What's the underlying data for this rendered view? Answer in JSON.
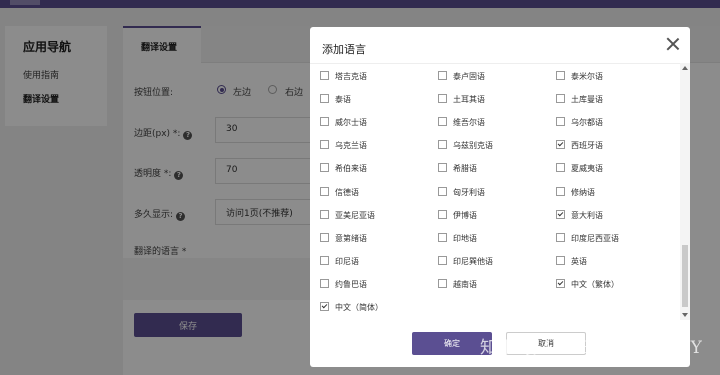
{
  "sidebar": {
    "title": "应用导航",
    "items": [
      {
        "label": "使用指南"
      },
      {
        "label": "翻译设置"
      }
    ]
  },
  "main": {
    "tab": "翻译设置",
    "button_position_label": "按钮位置:",
    "position_left": "左边",
    "position_right": "右边",
    "margin_label": "边距(px) *:",
    "margin_value": "30",
    "opacity_label": "透明度 *:",
    "opacity_value": "70",
    "show_when_label": "多久显示:",
    "show_when_value": "访问1页(不推荐)",
    "languages_label": "翻译的语言 *",
    "save": "保存"
  },
  "dialog": {
    "title": "添加语言",
    "languages": [
      {
        "label": "塔吉克语",
        "checked": false
      },
      {
        "label": "泰卢固语",
        "checked": false
      },
      {
        "label": "泰米尔语",
        "checked": false
      },
      {
        "label": "泰语",
        "checked": false
      },
      {
        "label": "土耳其语",
        "checked": false
      },
      {
        "label": "土库曼语",
        "checked": false
      },
      {
        "label": "威尔士语",
        "checked": false
      },
      {
        "label": "维吾尔语",
        "checked": false
      },
      {
        "label": "乌尔都语",
        "checked": false
      },
      {
        "label": "乌克兰语",
        "checked": false
      },
      {
        "label": "乌兹别克语",
        "checked": false
      },
      {
        "label": "西班牙语",
        "checked": true
      },
      {
        "label": "希伯来语",
        "checked": false
      },
      {
        "label": "希腊语",
        "checked": false
      },
      {
        "label": "夏威夷语",
        "checked": false
      },
      {
        "label": "信德语",
        "checked": false
      },
      {
        "label": "匈牙利语",
        "checked": false
      },
      {
        "label": "修纳语",
        "checked": false
      },
      {
        "label": "亚美尼亚语",
        "checked": false
      },
      {
        "label": "伊博语",
        "checked": false
      },
      {
        "label": "意大利语",
        "checked": true
      },
      {
        "label": "意第绪语",
        "checked": false
      },
      {
        "label": "印地语",
        "checked": false
      },
      {
        "label": "印度尼西亚语",
        "checked": false
      },
      {
        "label": "印尼语",
        "checked": false
      },
      {
        "label": "印尼巽他语",
        "checked": false
      },
      {
        "label": "英语",
        "checked": false
      },
      {
        "label": "约鲁巴语",
        "checked": false
      },
      {
        "label": "越南语",
        "checked": false
      },
      {
        "label": "中文（繁体）",
        "checked": true
      },
      {
        "label": "中文（简体）",
        "checked": true
      }
    ],
    "confirm": "确定",
    "cancel": "取消"
  },
  "watermark": "知乎 @ALLEN-SHOPIFY",
  "colors": {
    "accent": "#5b4f92"
  }
}
